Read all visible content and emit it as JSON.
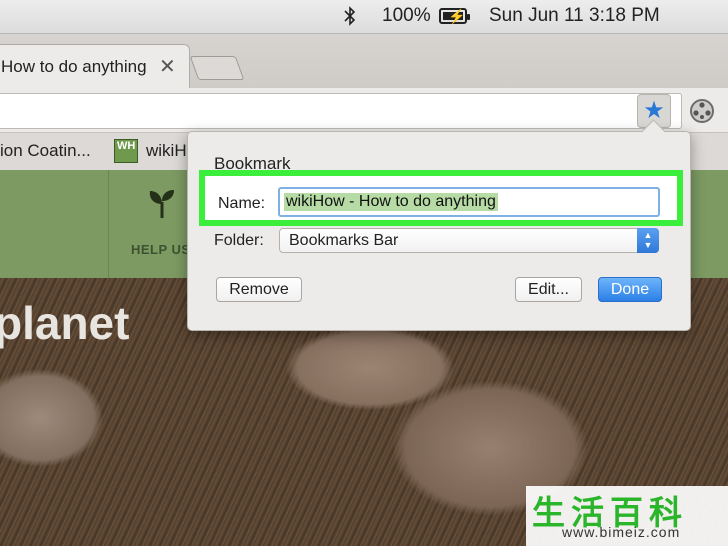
{
  "menubar": {
    "battery_percent": "100%",
    "clock": "Sun Jun 11  3:18 PM",
    "icons": [
      "bluetooth-icon",
      "battery-charging-icon"
    ]
  },
  "browser": {
    "tab_title": "How to do anything",
    "tab_close": "✕",
    "toolbar_icons": [
      "bookmark-star-icon",
      "extension-icon"
    ]
  },
  "bookmarks_bar": {
    "items": [
      {
        "label": "ion Coatin..."
      },
      {
        "label": "wikiH",
        "favicon_text": "WH"
      }
    ]
  },
  "page": {
    "help_label": "HELP US",
    "hero_text": "planet",
    "header_color": "#7c9a62"
  },
  "dialog": {
    "title": "Bookmark",
    "name_label": "Name:",
    "name_value": "wikiHow - How to do anything",
    "folder_label": "Folder:",
    "folder_value": "Bookmarks Bar",
    "remove_label": "Remove",
    "edit_label": "Edit...",
    "done_label": "Done",
    "highlight_color": "#3cee3c",
    "accent_color": "#2b7fe6"
  },
  "watermark": {
    "chinese": "生活百科",
    "url": "www.bimeiz.com"
  }
}
